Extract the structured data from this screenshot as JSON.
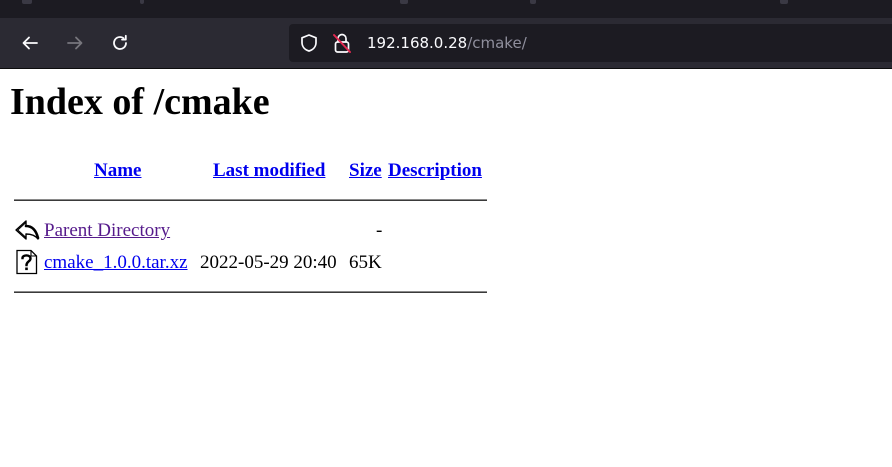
{
  "browser": {
    "url_host": "192.168.0.28",
    "url_path": "/cmake/",
    "back_icon": "arrow-left-icon",
    "forward_icon": "arrow-right-icon",
    "reload_icon": "reload-icon",
    "shield_icon": "shield-icon",
    "lock_icon": "insecure-lock-icon"
  },
  "page": {
    "title": "Index of /cmake",
    "headers": {
      "name": "Name",
      "last_modified": "Last modified",
      "size": "Size",
      "description": "Description"
    },
    "rows": [
      {
        "icon": "back-arrow-icon",
        "name": "Parent Directory",
        "last_modified": "",
        "size": "-",
        "description": ""
      },
      {
        "icon": "unknown-file-icon",
        "name": "cmake_1.0.0.tar.xz",
        "last_modified": "2022-05-29 20:40",
        "size": "65K",
        "description": ""
      }
    ]
  },
  "colors": {
    "link": "#0000ee",
    "visited_link": "#551a8b",
    "toolbar_bg": "#2b2a33",
    "urlbar_bg": "#1c1b22"
  }
}
